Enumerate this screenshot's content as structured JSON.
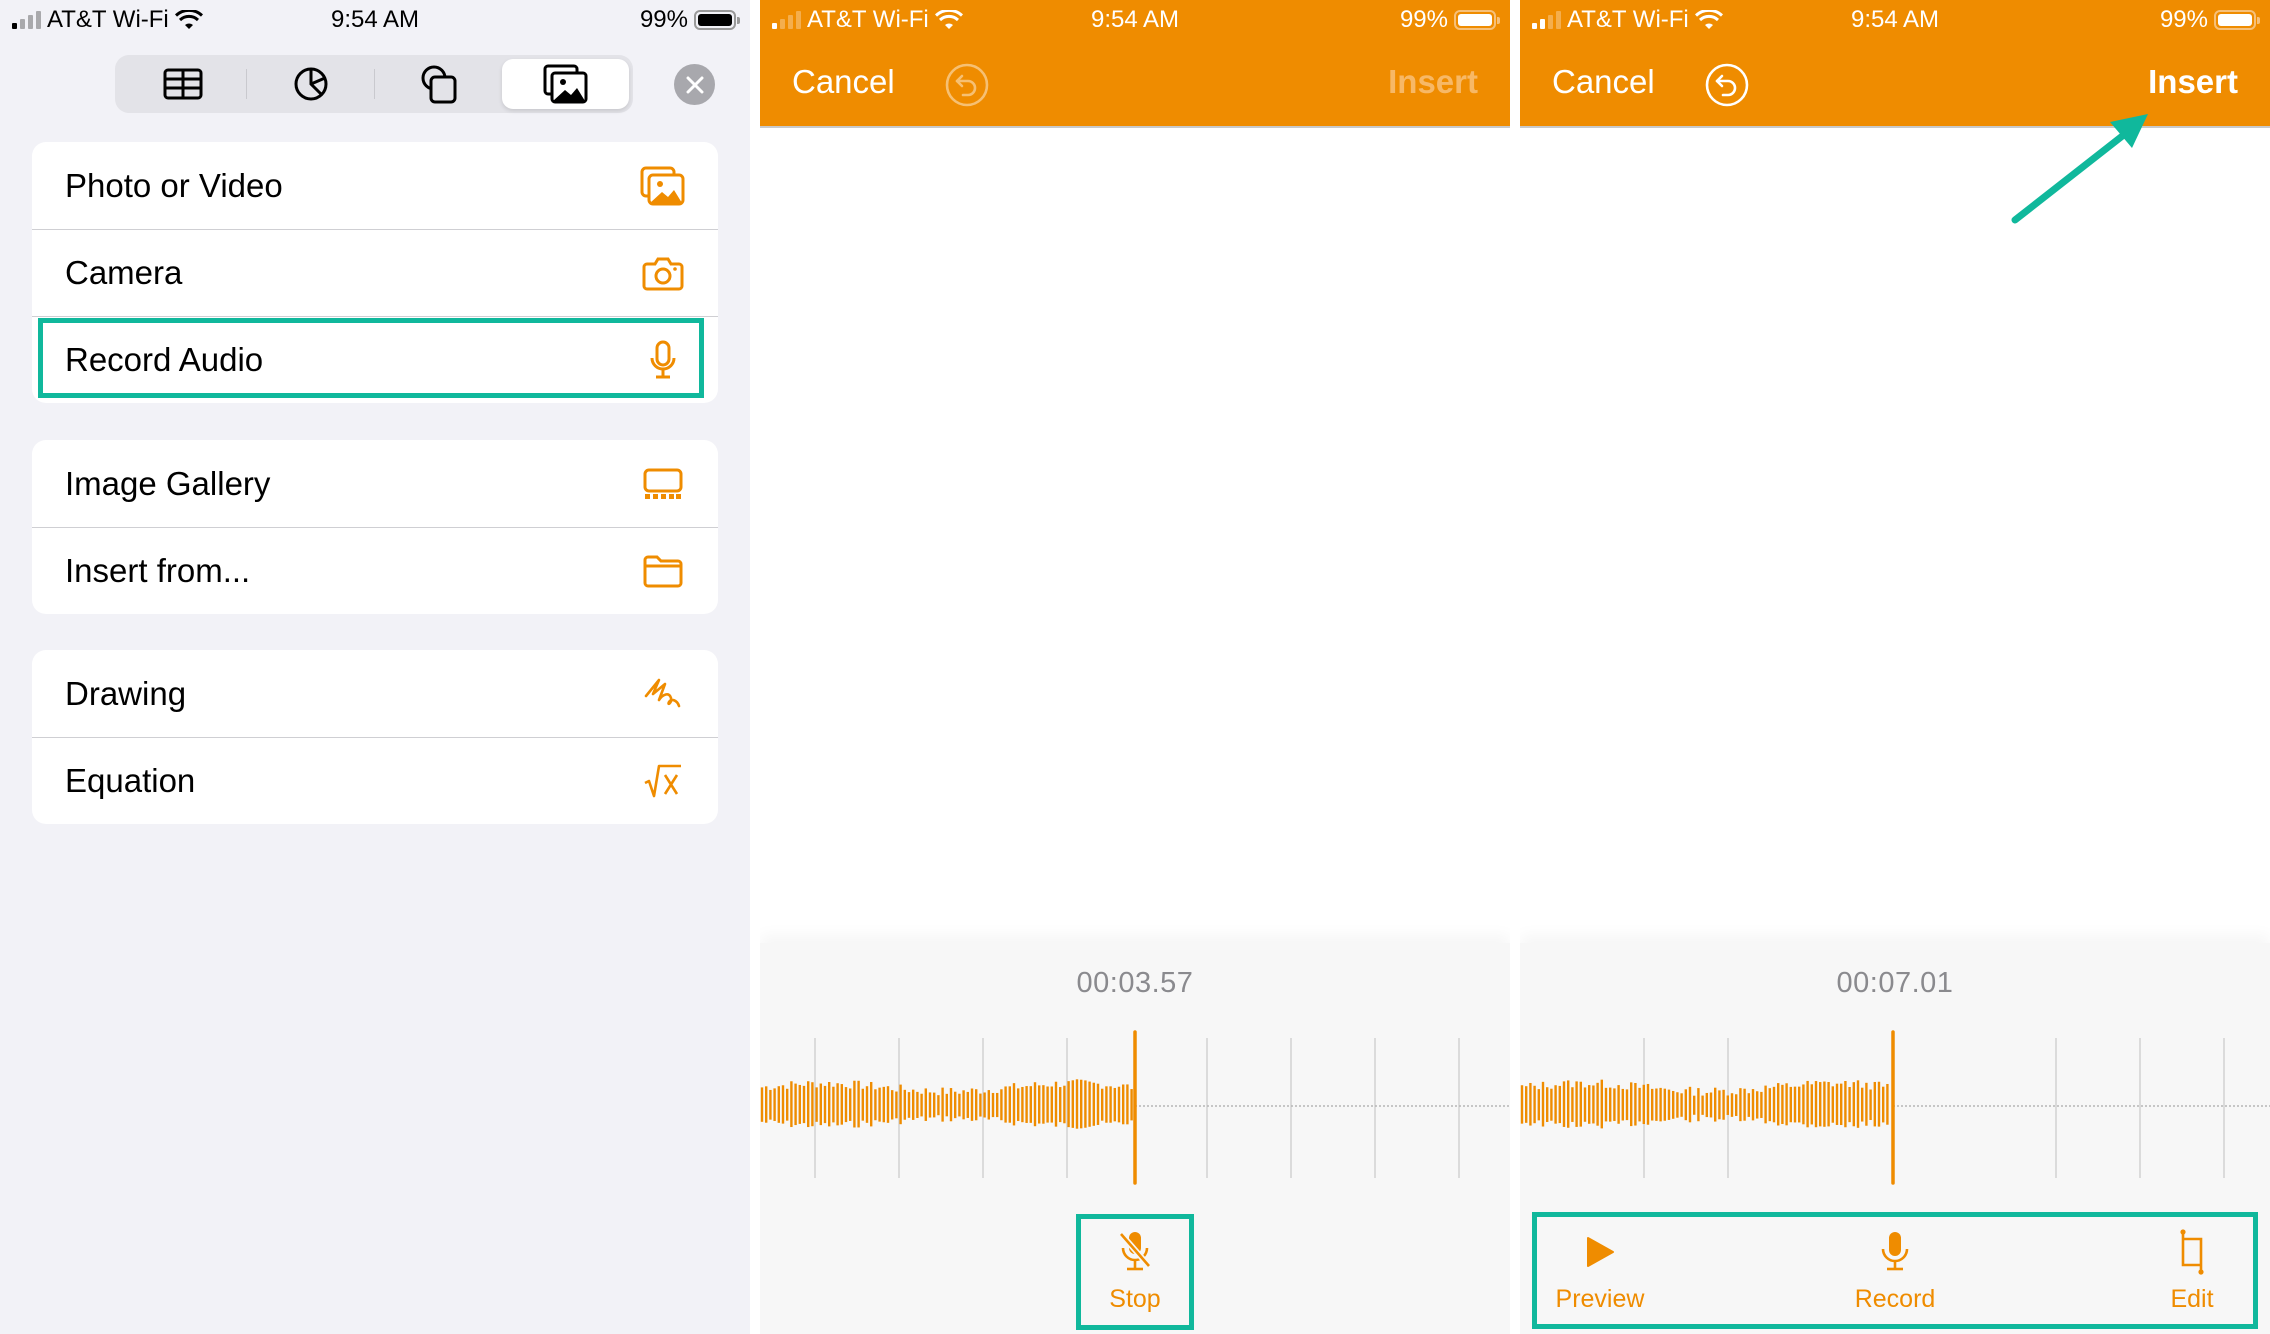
{
  "status_bar": {
    "carrier": "AT&T Wi-Fi",
    "time": "9:54 AM",
    "battery_percent": "99%"
  },
  "colors": {
    "accent": "#ef8c00",
    "highlight": "#10b89c",
    "grouped_bg": "#f2f2f7"
  },
  "insert_menu": {
    "segmented_tabs": [
      {
        "icon": "table-icon",
        "active": false
      },
      {
        "icon": "chart-icon",
        "active": false
      },
      {
        "icon": "shapes-icon",
        "active": false
      },
      {
        "icon": "media-icon",
        "active": true
      }
    ],
    "close_icon": "close-icon",
    "groups": [
      [
        {
          "label": "Photo or Video",
          "icon": "photo-icon"
        },
        {
          "label": "Camera",
          "icon": "camera-icon"
        },
        {
          "label": "Record Audio",
          "icon": "microphone-icon",
          "highlighted": true
        }
      ],
      [
        {
          "label": "Image Gallery",
          "icon": "image-gallery-icon"
        },
        {
          "label": "Insert from...",
          "icon": "folder-icon"
        }
      ],
      [
        {
          "label": "Drawing",
          "icon": "drawing-icon"
        },
        {
          "label": "Equation",
          "icon": "equation-icon"
        }
      ]
    ]
  },
  "recording_screen": {
    "nav": {
      "cancel": "Cancel",
      "insert": "Insert",
      "insert_enabled": false,
      "undo_enabled": false
    },
    "timer": "00:03.57",
    "actions": [
      {
        "label": "Stop",
        "icon": "microphone-slash-icon"
      }
    ]
  },
  "recorded_screen": {
    "nav": {
      "cancel": "Cancel",
      "insert": "Insert",
      "insert_enabled": true,
      "undo_enabled": true
    },
    "timer": "00:07.01",
    "actions": [
      {
        "label": "Preview",
        "icon": "play-icon"
      },
      {
        "label": "Record",
        "icon": "microphone-icon"
      },
      {
        "label": "Edit",
        "icon": "crop-icon"
      }
    ]
  }
}
